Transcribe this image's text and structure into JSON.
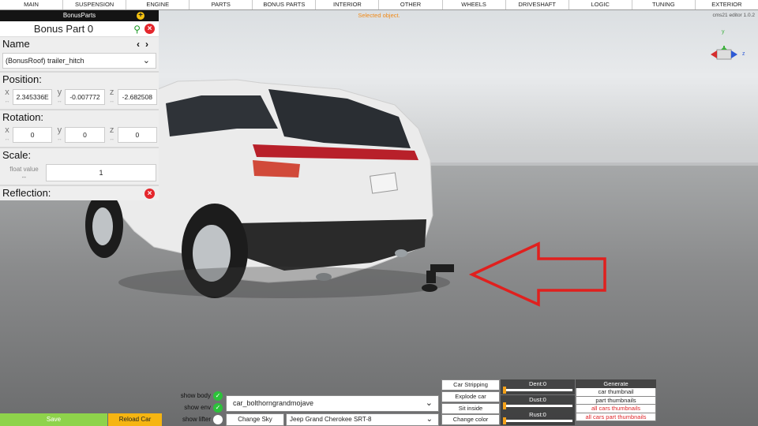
{
  "topbar": {
    "tabs": [
      "MAIN",
      "SUSPENSION",
      "ENGINE",
      "PARTS",
      "BONUS PARTS",
      "INTERIOR",
      "OTHER",
      "WHEELS",
      "DRIVESHAFT",
      "LOGIC",
      "TUNING",
      "EXTERIOR"
    ]
  },
  "status": {
    "selected": "Selected object.",
    "version": "cms21 editor 1.0.2"
  },
  "panel": {
    "header": "BonusParts",
    "part_name": "Bonus Part 0",
    "name_label": "Name",
    "name_value": "(BonusRoof) trailer_hitch",
    "position_label": "Position:",
    "position": {
      "x": "2.345336E",
      "y": "-0.007772",
      "z": "-2.682508"
    },
    "rotation_label": "Rotation:",
    "rotation": {
      "x": "0",
      "y": "0",
      "z": "0"
    },
    "scale_label": "Scale:",
    "scale_float_label": "float value",
    "scale_value": "1",
    "reflection_label": "Reflection:",
    "axes": {
      "x": "x",
      "y": "y",
      "z": "z",
      "sub": "↔"
    }
  },
  "gizmo": {
    "y": "y",
    "z": "z"
  },
  "bottom": {
    "save": "Save",
    "reload": "Reload Car",
    "show_body": "show body",
    "show_env": "show env",
    "show_lifter": "show lifter",
    "car_id": "car_bolthorngrandmojave",
    "change_sky": "Change Sky",
    "car_name": "Jeep Grand Cherokee SRT-8",
    "car_stripping": "Car Stripping",
    "explode_car": "Explode car",
    "sit_inside": "Sit inside",
    "change_color": "Change color",
    "dent": "Dent:0",
    "dust": "Dust:0",
    "rust": "Rust:0",
    "generate": "Generate",
    "car_thumbnail": "car thumbnail",
    "part_thumbnails": "part thumbnails",
    "all_cars_thumbnails": "all cars thumbnails",
    "all_cars_part_thumbnails": "all cars part thumbnails"
  },
  "colors": {
    "accent_green": "#8ed34b",
    "accent_orange": "#f6b512",
    "close_red": "#e4262c",
    "arrow_red": "#e0201e"
  }
}
